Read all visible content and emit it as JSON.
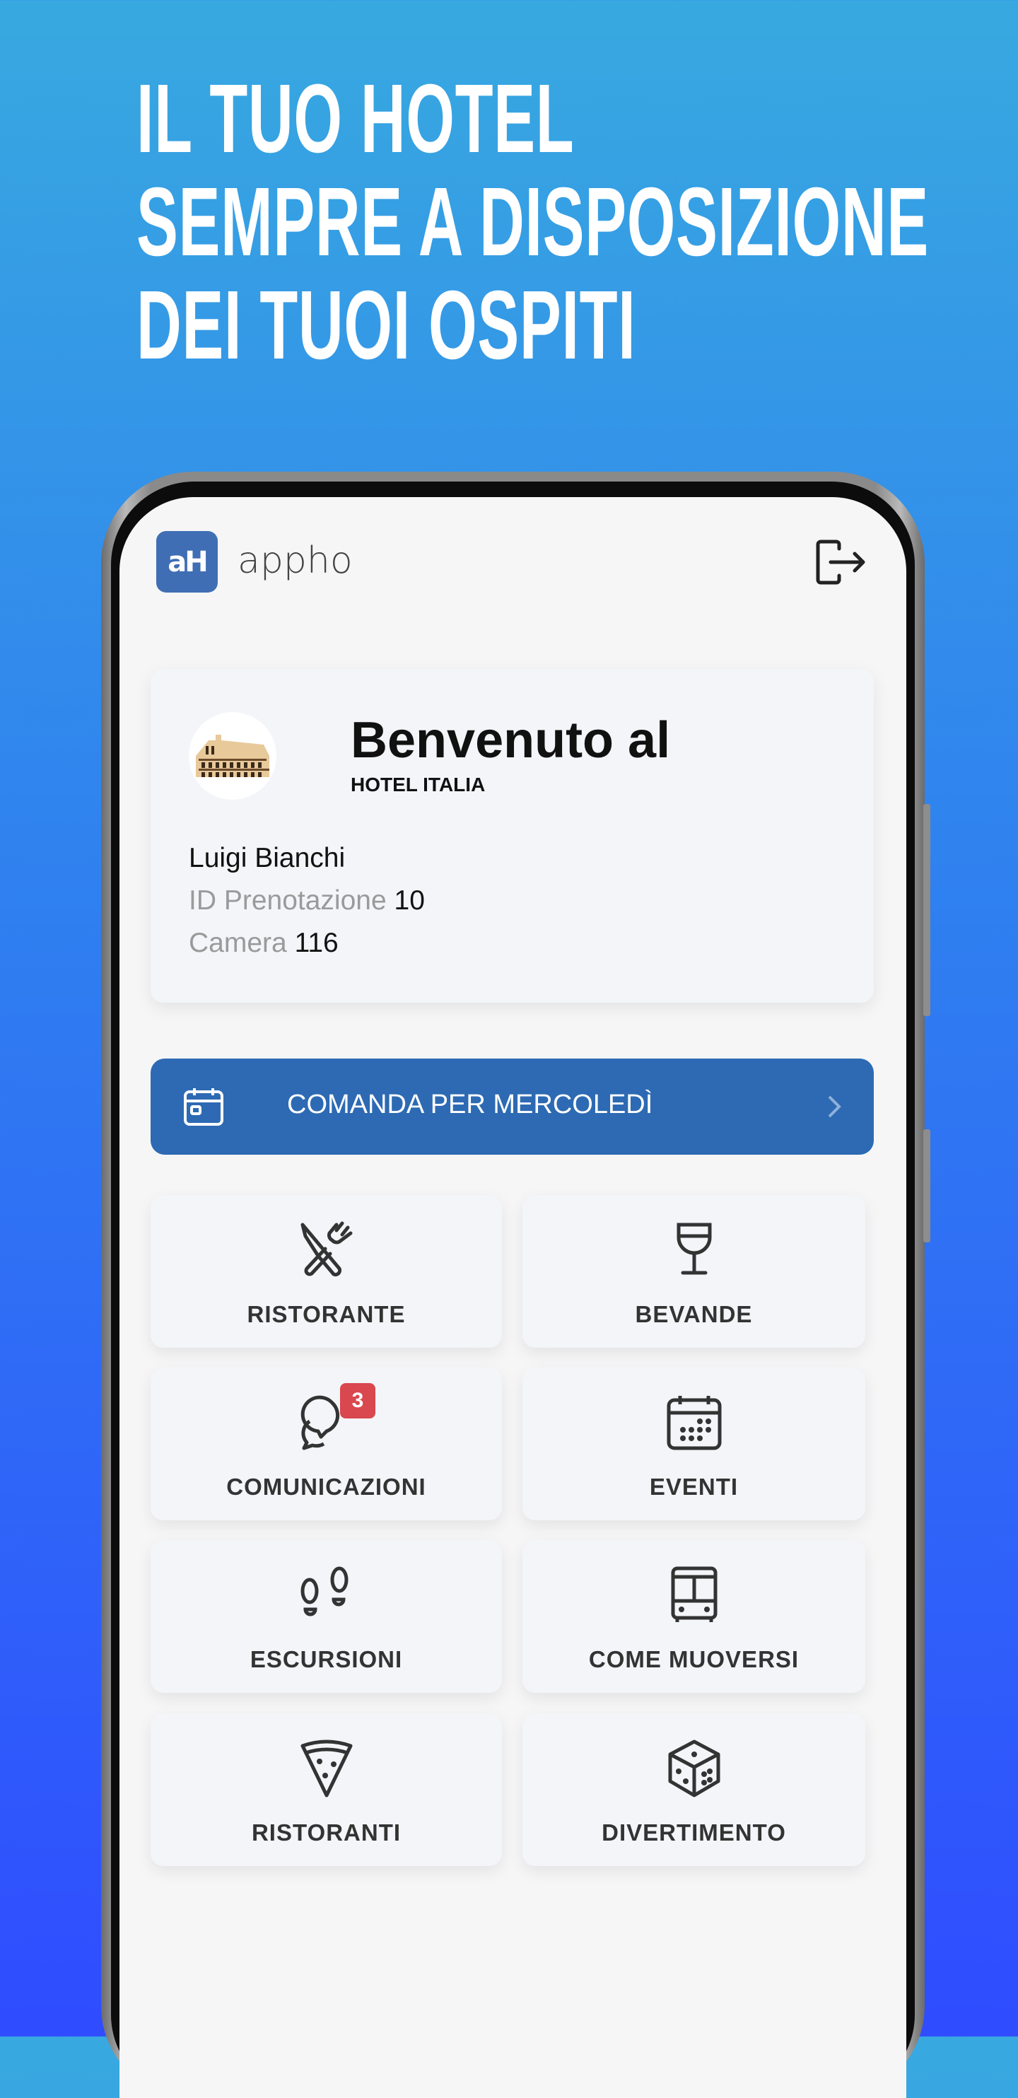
{
  "headline": {
    "lines": [
      "IL TUO HOTEL",
      "SEMPRE A DISPOSIZIONE",
      "DEI TUOI OSPITI"
    ]
  },
  "app": {
    "logo_text": "aH",
    "name": "appho"
  },
  "welcome": {
    "title": "Benvenuto al",
    "hotel": "HOTEL ITALIA",
    "guest": "Luigi Bianchi",
    "booking_label": "ID Prenotazione",
    "booking_id": "10",
    "room_label": "Camera",
    "room": "116"
  },
  "banner": {
    "label": "COMANDA PER MERCOLEDÌ",
    "color": "#2d6ab3"
  },
  "tiles": [
    {
      "label": "RISTORANTE",
      "icon": "cutlery-icon"
    },
    {
      "label": "BEVANDE",
      "icon": "wine-glass-icon"
    },
    {
      "label": "COMUNICAZIONI",
      "icon": "chat-bubbles-icon",
      "badge": "3"
    },
    {
      "label": "EVENTI",
      "icon": "calendar-icon"
    },
    {
      "label": "ESCURSIONI",
      "icon": "footprints-icon"
    },
    {
      "label": "COME MUOVERSI",
      "icon": "bus-icon"
    },
    {
      "label": "RISTORANTI",
      "icon": "pizza-icon"
    },
    {
      "label": "DIVERTIMENTO",
      "icon": "dice-icon"
    }
  ],
  "colors": {
    "badge": "#d9474f",
    "brand": "#3f6eb4"
  }
}
